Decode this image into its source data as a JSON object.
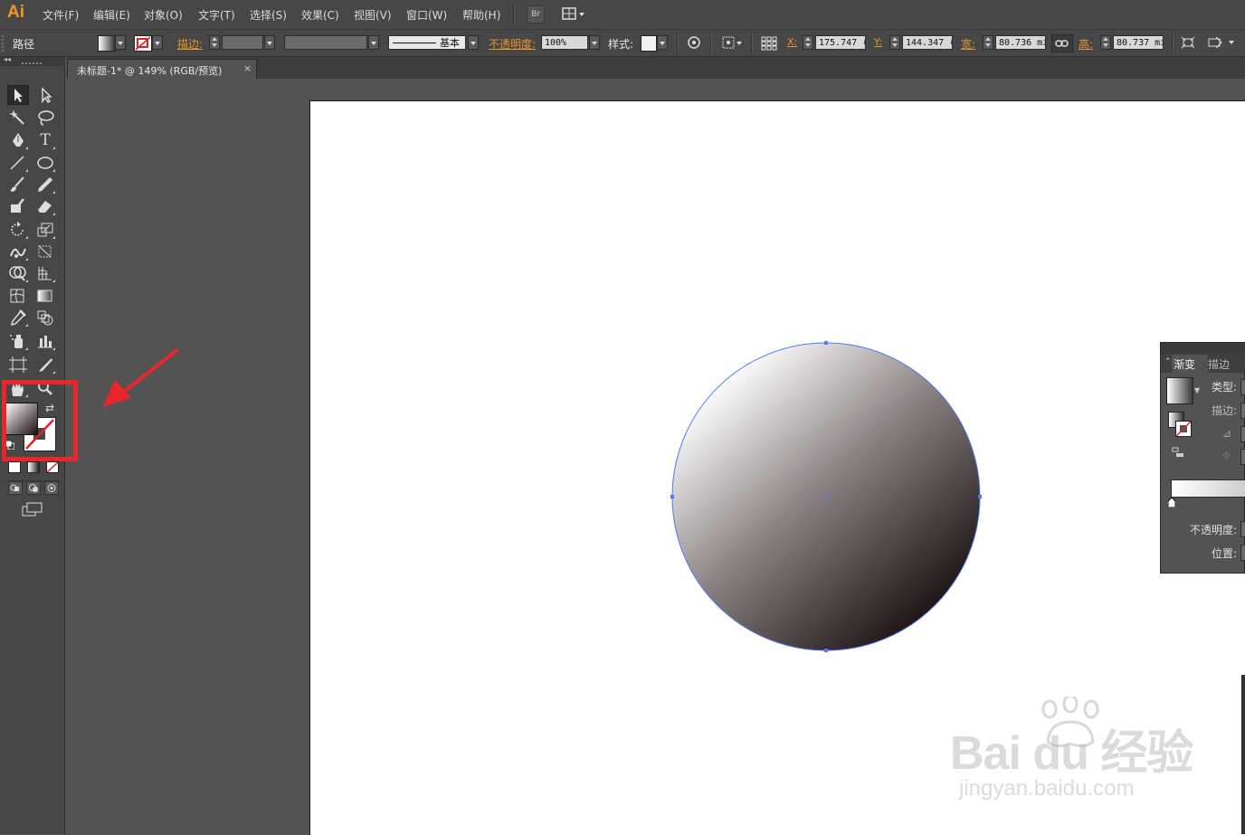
{
  "app": {
    "logo": "Ai"
  },
  "menu": [
    "文件(F)",
    "编辑(E)",
    "对象(O)",
    "文字(T)",
    "选择(S)",
    "效果(C)",
    "视图(V)",
    "窗口(W)",
    "帮助(H)"
  ],
  "menubar_buttons": {
    "bridge": "Br"
  },
  "control_bar": {
    "selection_type": "路径",
    "stroke_label": "描边:",
    "stroke_profile": "基本",
    "opacity_label": "不透明度:",
    "opacity_value": "100%",
    "style_label": "样式:",
    "x_label": "X:",
    "x_value": "175.747 (",
    "y_label": "Y:",
    "y_value": "144.347 (",
    "w_label": "宽:",
    "w_value": "80.736 mi",
    "h_label": "高:",
    "h_value": "80.737 mi"
  },
  "document_tab": {
    "title": "未标题-1* @ 149% (RGB/预览)",
    "close": "×"
  },
  "gradient_panel": {
    "tabs": [
      "渐变",
      "描边"
    ],
    "type_label": "类型:",
    "stroke_label": "描边:",
    "opacity_label": "不透明度:",
    "location_label": "位置:"
  },
  "watermark": {
    "main": "Bai du 经验",
    "sub": "jingyan.baidu.com"
  },
  "colors": {
    "accent_orange": "#e8962e",
    "highlight_red": "#e8262b",
    "selection_blue": "#4a78ff",
    "gradient_start": "#ffffff",
    "gradient_end": "#1a1011"
  },
  "icons": [
    "selection-tool-icon",
    "direct-selection-tool-icon",
    "magic-wand-icon",
    "lasso-icon",
    "pen-tool-icon",
    "type-tool-icon",
    "line-tool-icon",
    "ellipse-tool-icon",
    "paintbrush-icon",
    "pencil-icon",
    "blob-brush-icon",
    "eraser-icon",
    "rotate-icon",
    "scale-icon",
    "warp-icon",
    "free-transform-icon",
    "shape-builder-icon",
    "perspective-grid-icon",
    "mesh-icon",
    "gradient-tool-icon",
    "eyedropper-icon",
    "blend-icon",
    "symbol-sprayer-icon",
    "graph-icon",
    "artboard-icon",
    "slice-icon",
    "hand-icon",
    "zoom-icon"
  ]
}
